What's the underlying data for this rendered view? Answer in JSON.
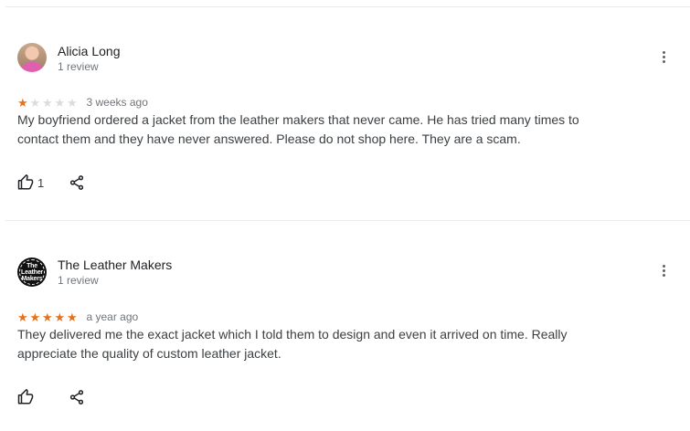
{
  "reviews": [
    {
      "author": "Alicia Long",
      "review_count": "1 review",
      "rating": 1,
      "max_rating": 5,
      "date": "3 weeks ago",
      "text": "My boyfriend ordered a jacket from the leather makers that never came. He has tried many times to contact them and they have never answered. Please do not shop here. They are a scam.",
      "likes": "1",
      "avatar_icon": "user-photo-avatar"
    },
    {
      "author": "The Leather Makers",
      "review_count": "1 review",
      "rating": 5,
      "max_rating": 5,
      "date": "a year ago",
      "text": "They delivered me the exact jacket which I told them to design and even it arrived on time. Really appreciate the quality of custom leather jacket.",
      "likes": "",
      "avatar_icon": "brand-logo-avatar",
      "avatar_logo_line1": "The Leather",
      "avatar_logo_line2": "Makers"
    }
  ],
  "colors": {
    "star_filled": "#e7711b",
    "star_empty": "#dadce0",
    "muted_text": "#70757a",
    "divider": "#e8eaed"
  }
}
